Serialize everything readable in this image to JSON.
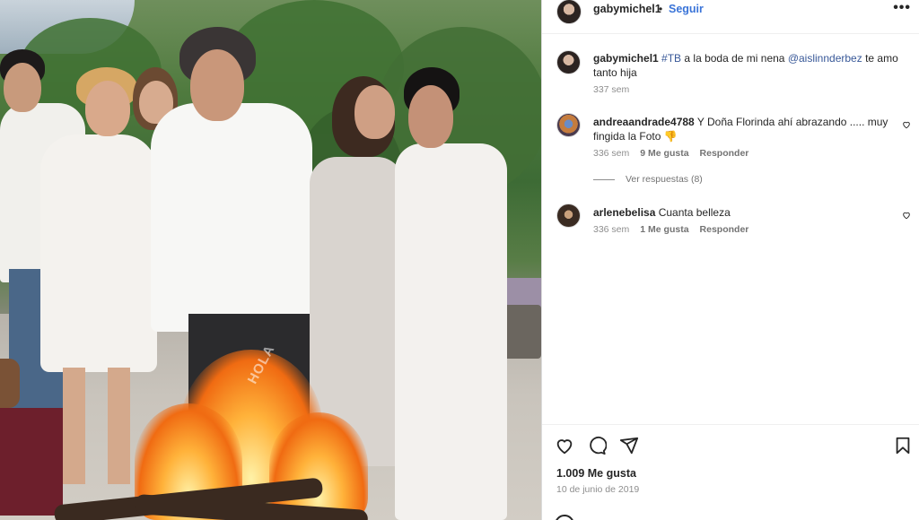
{
  "post": {
    "username": "gabymichel1",
    "follow_label": "Seguir",
    "separator": "•",
    "more_label": "•••"
  },
  "image": {
    "watermark": "HOLA"
  },
  "caption": {
    "username": "gabymichel1",
    "hashtag": "#TB",
    "text_part1": " a la boda de mi nena ",
    "mention": "@aislinnderbez",
    "text_part2": " te amo tanto hija",
    "time": "337 sem"
  },
  "comments": [
    {
      "username": "andreaandrade4788",
      "text": "Y Doña Florinda ahí abrazando ..... muy fingida la Foto 👎",
      "time": "336 sem",
      "likes": "9 Me gusta",
      "reply_label": "Responder",
      "view_replies": "Ver respuestas (8)"
    },
    {
      "username": "arlenebelisa",
      "text": "Cuanta belleza",
      "time": "336 sem",
      "likes": "1 Me gusta",
      "reply_label": "Responder"
    }
  ],
  "footer": {
    "likes": "1.009 Me gusta",
    "date": "10 de junio de 2019"
  },
  "icons": [
    "heart-icon",
    "comment-icon",
    "share-icon",
    "bookmark-icon",
    "more-icon"
  ]
}
